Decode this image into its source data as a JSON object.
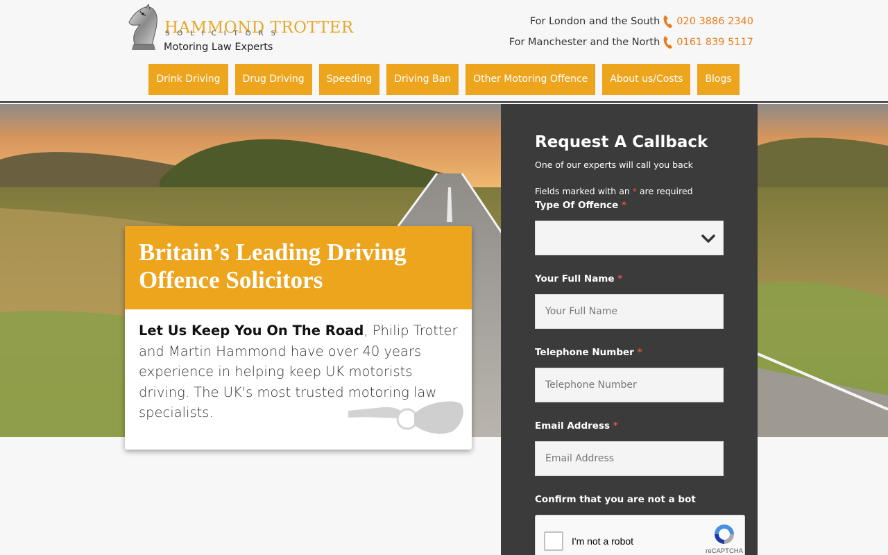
{
  "brand": {
    "name": "HAMMOND TROTTER",
    "subtitle": "SOLICITORS",
    "tagline": "Motoring Law Experts",
    "accent": "#eea51e",
    "phone_color": "#e87c1e"
  },
  "contacts": [
    {
      "label": "For London and the South",
      "number": "020 3886 2340"
    },
    {
      "label": "For Manchester and the North",
      "number": "0161 839 5117"
    }
  ],
  "nav": [
    "Drink Driving",
    "Drug Driving",
    "Speeding",
    "Driving Ban",
    "Other Motoring Offence",
    "About us/Costs",
    "Blogs"
  ],
  "hero": {
    "title_line1": "Britain’s Leading Driving",
    "title_line2": "Offence Solicitors",
    "body_strong": "Let Us Keep You On The Road",
    "body_text": ", Philip Trotter and Martin Hammond have  over 40 years experience in helping keep UK motorists driving. The UK's most trusted motoring law specialists."
  },
  "form": {
    "title": "Request A Callback",
    "subtitle": "One of our experts will call you back",
    "required_prefix": "Fields marked with an",
    "required_star": "*",
    "required_suffix": "are required",
    "fields": {
      "offence": {
        "label": "Type Of Offence",
        "value": ""
      },
      "name": {
        "label": "Your Full Name",
        "placeholder": "Your Full Name"
      },
      "phone": {
        "label": "Telephone Number",
        "placeholder": "Telephone Number"
      },
      "email": {
        "label": "Email Address",
        "placeholder": "Email Address"
      }
    },
    "bot_label": "Confirm that you are not a bot",
    "recaptcha": {
      "label": "I'm not a robot",
      "brand": "reCAPTCHA"
    }
  }
}
